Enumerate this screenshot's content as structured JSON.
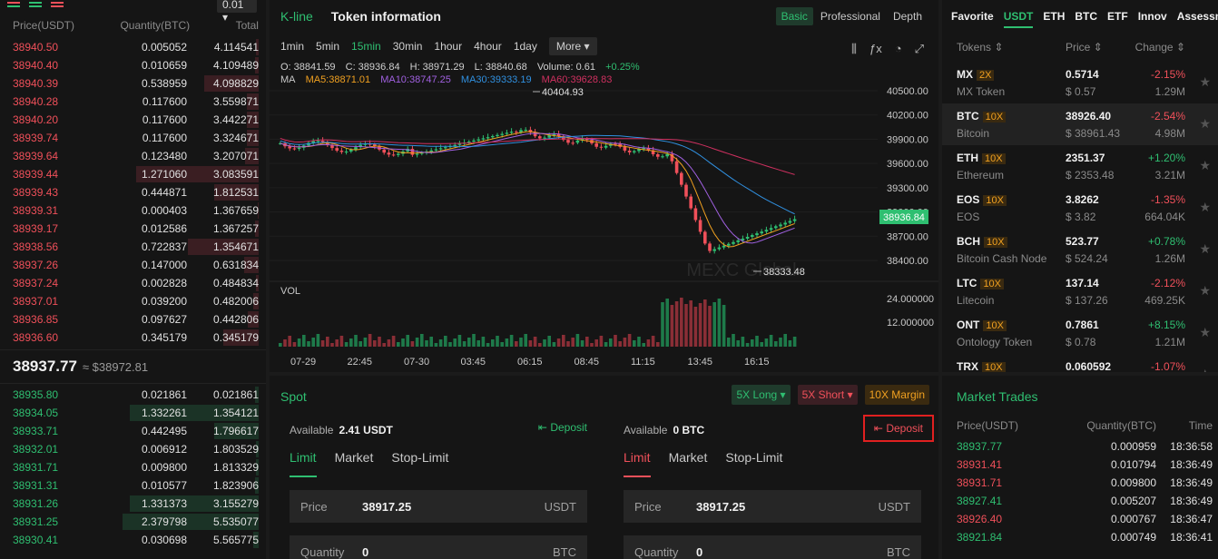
{
  "orderbook": {
    "precision": "0.01",
    "headers": {
      "price": "Price(USDT)",
      "quantity": "Quantity(BTC)",
      "total": "Total"
    },
    "asks": [
      {
        "price": "38940.50",
        "qty": "0.005052",
        "total": "4.114541",
        "depth": 0.02
      },
      {
        "price": "38940.40",
        "qty": "0.010659",
        "total": "4.109489",
        "depth": 0.03
      },
      {
        "price": "38940.39",
        "qty": "0.538959",
        "total": "4.098829",
        "depth": 0.4
      },
      {
        "price": "38940.28",
        "qty": "0.117600",
        "total": "3.559871",
        "depth": 0.09
      },
      {
        "price": "38940.20",
        "qty": "0.117600",
        "total": "3.442271",
        "depth": 0.09
      },
      {
        "price": "38939.74",
        "qty": "0.117600",
        "total": "3.324671",
        "depth": 0.09
      },
      {
        "price": "38939.64",
        "qty": "0.123480",
        "total": "3.207071",
        "depth": 0.1
      },
      {
        "price": "38939.44",
        "qty": "1.271060",
        "total": "3.083591",
        "depth": 0.9
      },
      {
        "price": "38939.43",
        "qty": "0.444871",
        "total": "1.812531",
        "depth": 0.33
      },
      {
        "price": "38939.31",
        "qty": "0.000403",
        "total": "1.367659",
        "depth": 0.01
      },
      {
        "price": "38939.17",
        "qty": "0.012586",
        "total": "1.367257",
        "depth": 0.03
      },
      {
        "price": "38938.56",
        "qty": "0.722837",
        "total": "1.354671",
        "depth": 0.52
      },
      {
        "price": "38937.26",
        "qty": "0.147000",
        "total": "0.631834",
        "depth": 0.11
      },
      {
        "price": "38937.24",
        "qty": "0.002828",
        "total": "0.484834",
        "depth": 0.02
      },
      {
        "price": "38937.01",
        "qty": "0.039200",
        "total": "0.482006",
        "depth": 0.04
      },
      {
        "price": "38936.85",
        "qty": "0.097627",
        "total": "0.442806",
        "depth": 0.08
      },
      {
        "price": "38936.60",
        "qty": "0.345179",
        "total": "0.345179",
        "depth": 0.26
      }
    ],
    "last_price": "38937.77",
    "last_price_usd": "≈ $38972.81",
    "bids": [
      {
        "price": "38935.80",
        "qty": "0.021861",
        "total": "0.021861",
        "depth": 0.03
      },
      {
        "price": "38934.05",
        "qty": "1.332261",
        "total": "1.354121",
        "depth": 0.95
      },
      {
        "price": "38933.71",
        "qty": "0.442495",
        "total": "1.796617",
        "depth": 0.33
      },
      {
        "price": "38932.01",
        "qty": "0.006912",
        "total": "1.803529",
        "depth": 0.02
      },
      {
        "price": "38931.71",
        "qty": "0.009800",
        "total": "1.813329",
        "depth": 0.02
      },
      {
        "price": "38931.31",
        "qty": "0.010577",
        "total": "1.823906",
        "depth": 0.03
      },
      {
        "price": "38931.26",
        "qty": "1.331373",
        "total": "3.155279",
        "depth": 0.95
      },
      {
        "price": "38931.25",
        "qty": "2.379798",
        "total": "5.535077",
        "depth": 1.0
      },
      {
        "price": "38930.41",
        "qty": "0.030698",
        "total": "5.565775",
        "depth": 0.04
      }
    ]
  },
  "chart": {
    "tab_kline": "K-line",
    "tab_token": "Token information",
    "views": [
      "Basic",
      "Professional",
      "Depth"
    ],
    "intervals": [
      "1min",
      "5min",
      "15min",
      "30min",
      "1hour",
      "4hour",
      "1day"
    ],
    "active_interval": "15min",
    "more_label": "More ▾",
    "ohlc": {
      "o": "O: 38841.59",
      "c": "C: 38936.84",
      "h": "H: 38971.29",
      "l": "L: 38840.68",
      "volume": "Volume: 0.61",
      "change": "+0.25%"
    },
    "ma": {
      "label": "MA",
      "ma5": "MA5:38871.01",
      "ma10": "MA10:38747.25",
      "ma30": "MA30:39333.19",
      "ma60": "MA60:39628.83"
    },
    "high_marker": "40404.93",
    "low_marker": "38333.48",
    "current_price_tag": "38936.84",
    "y_ticks": [
      "40500.00",
      "40200.00",
      "39900.00",
      "39600.00",
      "39300.00",
      "39000.00",
      "38700.00",
      "38400.00"
    ],
    "vol_label": "VOL",
    "vol_ticks": [
      "24.000000",
      "12.000000"
    ],
    "x_ticks": [
      "07-29",
      "22:45",
      "07-30",
      "03:45",
      "06:15",
      "08:45",
      "11:15",
      "13:45",
      "16:15"
    ],
    "watermark": "MEXC Global",
    "colors": {
      "up": "#2fbf71",
      "down": "#f0505a",
      "ma5": "#f0a020",
      "ma10": "#a060e0",
      "ma30": "#3090e0",
      "ma60": "#d03060"
    }
  },
  "market": {
    "tabs": [
      "Favorite",
      "USDT",
      "ETH",
      "BTC",
      "ETF",
      "Innov",
      "Assessment"
    ],
    "active_tab": "USDT",
    "headers": {
      "tokens": "Tokens ⇕",
      "price": "Price ⇕",
      "change": "Change ⇕"
    },
    "rows": [
      {
        "sym": "MX",
        "lev": "2X",
        "price": "0.5714",
        "change": "-2.15%",
        "name": "MX Token",
        "usd": "$ 0.57",
        "vol": "1.29M",
        "up": false
      },
      {
        "sym": "BTC",
        "lev": "10X",
        "price": "38926.40",
        "change": "-2.54%",
        "name": "Bitcoin",
        "usd": "$ 38961.43",
        "vol": "4.98M",
        "up": false
      },
      {
        "sym": "ETH",
        "lev": "10X",
        "price": "2351.37",
        "change": "+1.20%",
        "name": "Ethereum",
        "usd": "$ 2353.48",
        "vol": "3.21M",
        "up": true
      },
      {
        "sym": "EOS",
        "lev": "10X",
        "price": "3.8262",
        "change": "-1.35%",
        "name": "EOS",
        "usd": "$ 3.82",
        "vol": "664.04K",
        "up": false
      },
      {
        "sym": "BCH",
        "lev": "10X",
        "price": "523.77",
        "change": "+0.78%",
        "name": "Bitcoin Cash Node",
        "usd": "$ 524.24",
        "vol": "1.26M",
        "up": true
      },
      {
        "sym": "LTC",
        "lev": "10X",
        "price": "137.14",
        "change": "-2.12%",
        "name": "Litecoin",
        "usd": "$ 137.26",
        "vol": "469.25K",
        "up": false
      },
      {
        "sym": "ONT",
        "lev": "10X",
        "price": "0.7861",
        "change": "+8.15%",
        "name": "Ontology Token",
        "usd": "$ 0.78",
        "vol": "1.21M",
        "up": true
      },
      {
        "sym": "TRX",
        "lev": "10X",
        "price": "0.060592",
        "change": "-1.07%",
        "name": "",
        "usd": "",
        "vol": "",
        "up": false
      }
    ]
  },
  "spot": {
    "title": "Spot",
    "btn_long": "5X Long ▾",
    "btn_short": "5X Short ▾",
    "btn_margin": "10X Margin",
    "buy": {
      "avail_label": "Available",
      "avail_value": "2.41 USDT",
      "deposit": "Deposit",
      "tabs": [
        "Limit",
        "Market",
        "Stop-Limit"
      ],
      "price_label": "Price",
      "price_value": "38917.25",
      "price_unit": "USDT",
      "qty_label": "Quantity",
      "qty_value": "0",
      "qty_unit": "BTC"
    },
    "sell": {
      "avail_label": "Available",
      "avail_value": "0 BTC",
      "deposit": "Deposit",
      "tabs": [
        "Limit",
        "Market",
        "Stop-Limit"
      ],
      "price_label": "Price",
      "price_value": "38917.25",
      "price_unit": "USDT",
      "qty_label": "Quantity",
      "qty_value": "0",
      "qty_unit": "BTC"
    }
  },
  "trades": {
    "title": "Market Trades",
    "headers": {
      "price": "Price(USDT)",
      "qty": "Quantity(BTC)",
      "time": "Time"
    },
    "rows": [
      {
        "price": "38937.77",
        "qty": "0.000959",
        "time": "18:36:58",
        "up": true
      },
      {
        "price": "38931.41",
        "qty": "0.010794",
        "time": "18:36:49",
        "up": false
      },
      {
        "price": "38931.71",
        "qty": "0.009800",
        "time": "18:36:49",
        "up": false
      },
      {
        "price": "38927.41",
        "qty": "0.005207",
        "time": "18:36:49",
        "up": true
      },
      {
        "price": "38926.40",
        "qty": "0.000767",
        "time": "18:36:47",
        "up": false
      },
      {
        "price": "38921.84",
        "qty": "0.000749",
        "time": "18:36:41",
        "up": true
      }
    ]
  }
}
